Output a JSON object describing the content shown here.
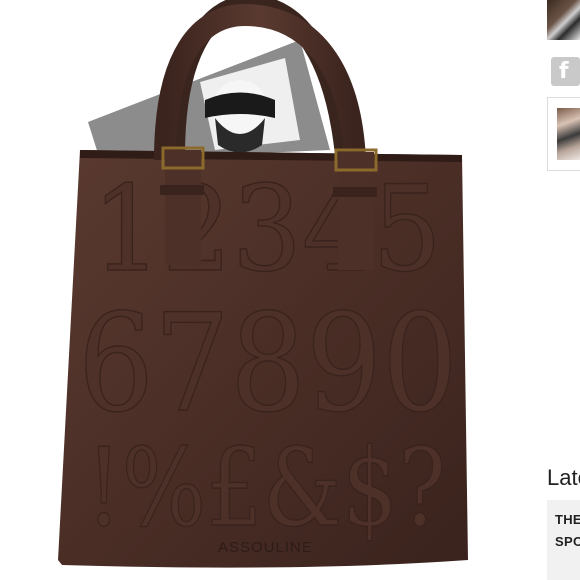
{
  "product": {
    "brand_stamp": "ASSOULINE",
    "embossed_rows": [
      "12345",
      "67890",
      "!%£&$?"
    ]
  },
  "sidebar": {
    "facebook_label": "f",
    "latest_heading": "Late",
    "latest_item_line1": "THE",
    "latest_item_line2": "SPO"
  }
}
